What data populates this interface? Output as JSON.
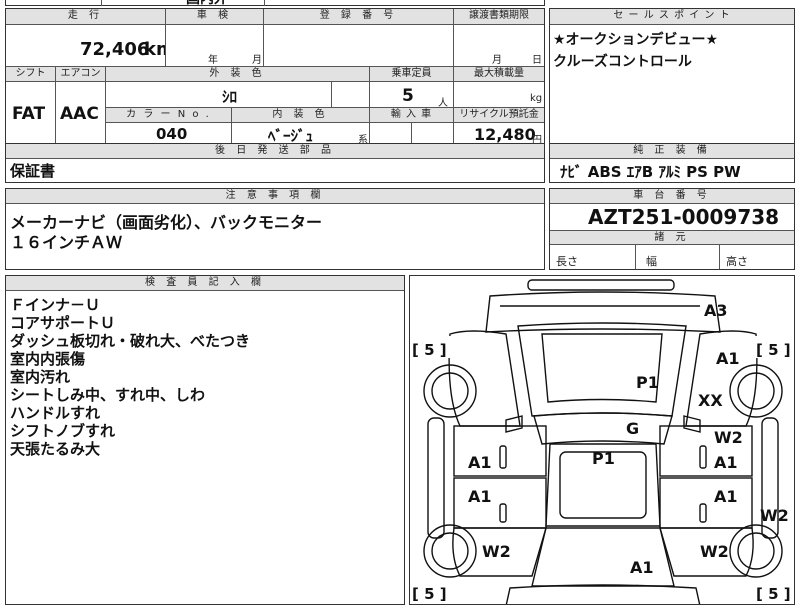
{
  "top_strip": {
    "partial_text": "国内外"
  },
  "mileage": {
    "header": "走 行",
    "value": "72,406",
    "unit": "km"
  },
  "inspection": {
    "header": "車 検",
    "year_unit": "年",
    "month_unit": "月"
  },
  "registration": {
    "header": "登 録 番 号"
  },
  "transfer_deadline": {
    "header": "譲渡書類期限",
    "month_unit": "月",
    "day_unit": "日"
  },
  "shift": {
    "header": "シフト",
    "value": "FAT"
  },
  "aircon": {
    "header": "エアコン",
    "value": "AAC"
  },
  "exterior_color": {
    "header": "外 装 色",
    "value": "ｼﾛ"
  },
  "capacity": {
    "header": "乗車定員",
    "value": "5",
    "unit": "人"
  },
  "max_load": {
    "header": "最大積載量",
    "unit": "kg"
  },
  "color_no": {
    "header": "カ ラ ー N o .",
    "value": "040"
  },
  "interior_color": {
    "header": "内 装 色",
    "value": "ﾍﾞｰｼﾞｭ",
    "suffix": "系"
  },
  "import": {
    "header": "輸 入 車"
  },
  "recycle": {
    "header": "リサイクル預託金",
    "value": "12,480",
    "unit": "円"
  },
  "sales_points": {
    "header": "セ ー ル ス ポ イ ン ト",
    "lines": [
      "★オークションデビュー★",
      "クルーズコントロール"
    ]
  },
  "later_parts": {
    "header": "後 日 発 送 部 品",
    "value": "保証書"
  },
  "genuine_equipment": {
    "header": "純 正 装 備",
    "value": "ﾅﾋﾞ ABS ｴｱB ｱﾙﾐ PS PW"
  },
  "notes": {
    "header": "注 意 事 項 欄",
    "lines": [
      "メーカーナビ（画面劣化）、バックモニター",
      "１６インチＡＷ"
    ]
  },
  "chassis": {
    "header": "車 台 番 号",
    "value": "AZT251-0009738"
  },
  "dimensions": {
    "header": "諸 元",
    "length": "長さ",
    "width": "幅",
    "height": "高さ"
  },
  "inspector": {
    "header": "検 査 員 記 入 欄",
    "lines": [
      "Ｆインナ－Ｕ",
      "コアサポートＵ",
      "ダッシュ板切れ・破れ大、べたつき",
      "室内内張傷",
      "室内汚れ",
      "シートしみ中、すれ中、しわ",
      "ハンドルすれ",
      "シフトノブすれ",
      "天張たるみ大"
    ]
  },
  "diagram": {
    "marks": [
      "A3",
      "A1",
      "P1",
      "XX",
      "G",
      "W2",
      "A1",
      "P1",
      "A1",
      "A1",
      "A1",
      "W2",
      "W2",
      "W2",
      "A1"
    ],
    "tire_marks": [
      "[ 5 ]",
      "[ 5 ]",
      "[ 5 ]",
      "[ 5 ]"
    ]
  }
}
